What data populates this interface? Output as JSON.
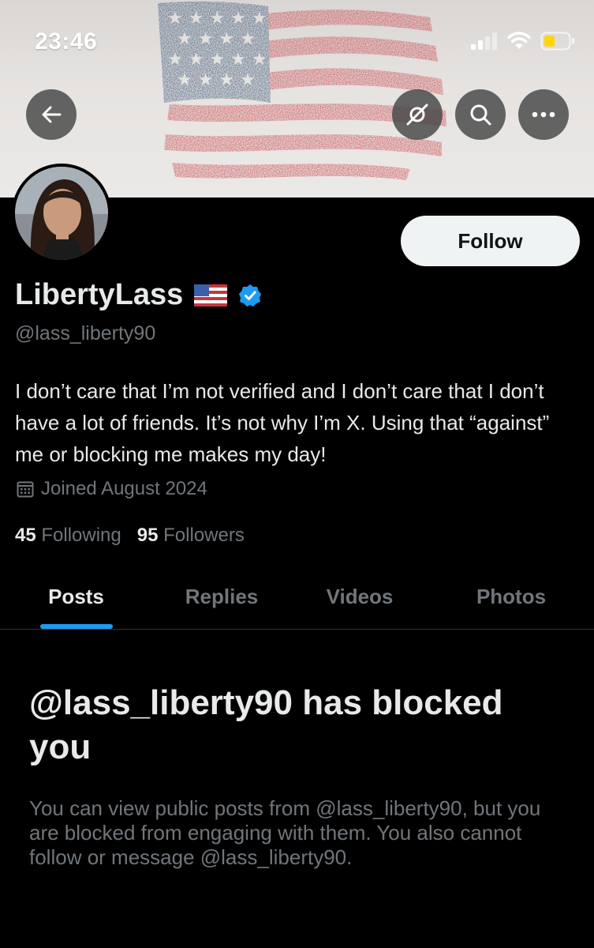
{
  "status_bar": {
    "time": "23:46",
    "signal_icon": "cellular-signal-icon",
    "wifi_icon": "wifi-icon",
    "battery_icon": "battery-low-icon",
    "battery_color": "#ffd60a"
  },
  "banner": {
    "image": "distressed-american-flag-banner",
    "back_icon": "back-arrow-icon",
    "hide_icon": "eye-slash-icon",
    "search_icon": "search-icon",
    "more_icon": "more-horizontal-icon"
  },
  "profile": {
    "avatar": "profile-photo",
    "follow_label": "Follow",
    "display_name": "LibertyLass",
    "flag_emoji": "🇺🇸",
    "verified_icon": "verified-badge-icon",
    "verified_color": "#1d9bf0",
    "handle": "@lass_liberty90",
    "bio": "I don’t care that I’m not verified and I don’t care that I don’t have a lot of friends. It’s not why I’m X. Using that “against” me or blocking me makes my day!",
    "joined_icon": "calendar-icon",
    "joined": "Joined August 2024",
    "following_count": "45",
    "following_label": "Following",
    "followers_count": "95",
    "followers_label": "Followers"
  },
  "tabs": [
    {
      "label": "Posts",
      "active": true
    },
    {
      "label": "Replies",
      "active": false
    },
    {
      "label": "Videos",
      "active": false
    },
    {
      "label": "Photos",
      "active": false
    }
  ],
  "blocked": {
    "title": "@lass_liberty90 has blocked you",
    "message": "You can view public posts from @lass_liberty90, but you are blocked from engaging with them. You also cannot follow or message @lass_liberty90."
  },
  "colors": {
    "background": "#000000",
    "text_primary": "#e7e9ea",
    "text_secondary": "#71767b",
    "accent": "#1d9bf0",
    "follow_button_bg": "#eff3f4"
  }
}
